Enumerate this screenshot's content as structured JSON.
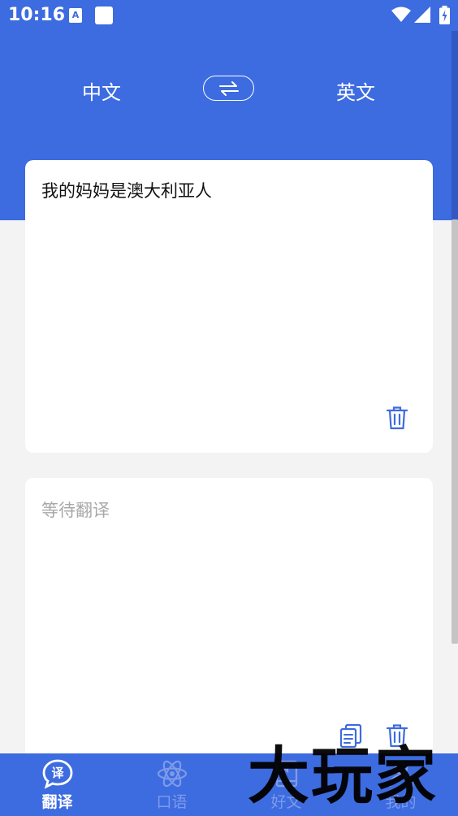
{
  "status_bar": {
    "time": "10:16",
    "a_icon_letter": "A"
  },
  "header": {
    "source_language": "中文",
    "target_language": "英文"
  },
  "input_card": {
    "text": "我的妈妈是澳大利亚人"
  },
  "output_card": {
    "placeholder": "等待翻译"
  },
  "tab_bar": {
    "tabs": [
      {
        "label": "翻译",
        "icon": "translate-bubble-icon",
        "active": true
      },
      {
        "label": "口语",
        "icon": "atom-icon",
        "active": false
      },
      {
        "label": "好文",
        "icon": "book-icon",
        "active": false
      },
      {
        "label": "我的",
        "icon": "user-icon",
        "active": false
      }
    ]
  },
  "watermark": {
    "text": "大玩家"
  },
  "colors": {
    "primary": "#3d6be0",
    "background": "#f3f3f3",
    "inactive_tab": "#7d9be8",
    "placeholder": "#a8a8a8"
  }
}
